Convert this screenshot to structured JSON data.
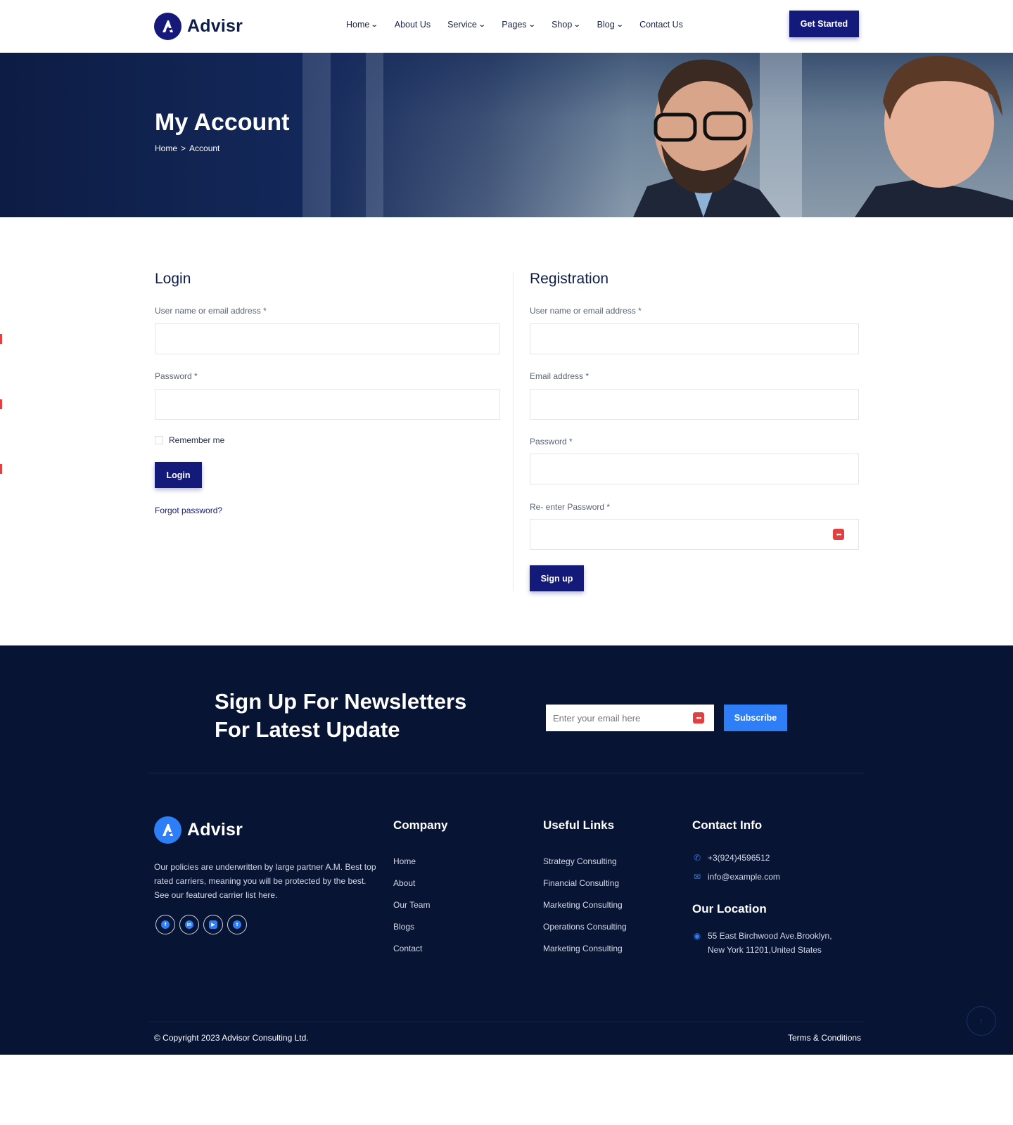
{
  "brand": {
    "name": "Advisr"
  },
  "nav": {
    "items": [
      {
        "label": "Home",
        "dropdown": true
      },
      {
        "label": "About Us",
        "dropdown": false
      },
      {
        "label": "Service",
        "dropdown": true
      },
      {
        "label": "Pages",
        "dropdown": true
      },
      {
        "label": "Shop",
        "dropdown": true
      },
      {
        "label": "Blog",
        "dropdown": true
      },
      {
        "label": "Contact Us",
        "dropdown": false
      }
    ],
    "cta": "Get Started"
  },
  "hero": {
    "title": "My Account",
    "breadcrumb": {
      "home": "Home",
      "separator": ">",
      "current": "Account"
    }
  },
  "login": {
    "title": "Login",
    "username_label": "User name or email address",
    "password_label": "Password",
    "required_mark": "*",
    "remember_label": "Remember me",
    "submit_label": "Login",
    "forgot_label": "Forgot password?"
  },
  "registration": {
    "title": "Registration",
    "username_label": "User name or email address",
    "email_label": "Email address",
    "password_label": "Password",
    "reenter_label": "Re- enter Password",
    "required_mark": "*",
    "submit_label": "Sign up"
  },
  "newsletter": {
    "title_line1": "Sign Up For Newsletters",
    "title_line2": "For Latest Update",
    "placeholder": "Enter your email here",
    "button": "Subscribe"
  },
  "footer": {
    "about": "Our policies are underwritten by large partner A.M. Best top rated carriers, meaning you will be protected by the best. See our featured carrier list here.",
    "socials": [
      "facebook-icon",
      "linkedin-icon",
      "youtube-icon",
      "twitter-icon"
    ],
    "company": {
      "title": "Company",
      "links": [
        "Home",
        "About",
        "Our Team",
        "Blogs",
        "Contact"
      ]
    },
    "useful": {
      "title": "Useful Links",
      "links": [
        "Strategy Consulting",
        "Financial Consulting",
        "Marketing Consulting",
        "Operations Consulting",
        "Marketing Consulting"
      ]
    },
    "contact": {
      "title": "Contact Info",
      "phone": "+3(924)4596512",
      "email": "info@example.com"
    },
    "location": {
      "title": "Our Location",
      "line1": "55 East Birchwood Ave.Brooklyn,",
      "line2": "New York 11201,United States"
    },
    "copyright": "© Copyright 2023 Advisor Consulting Ltd.",
    "terms": "Terms & Conditions"
  },
  "colors": {
    "primary": "#141a7a",
    "accent": "#2d7ef7",
    "footer_bg": "#071434",
    "hero_bg": "#13285a"
  }
}
